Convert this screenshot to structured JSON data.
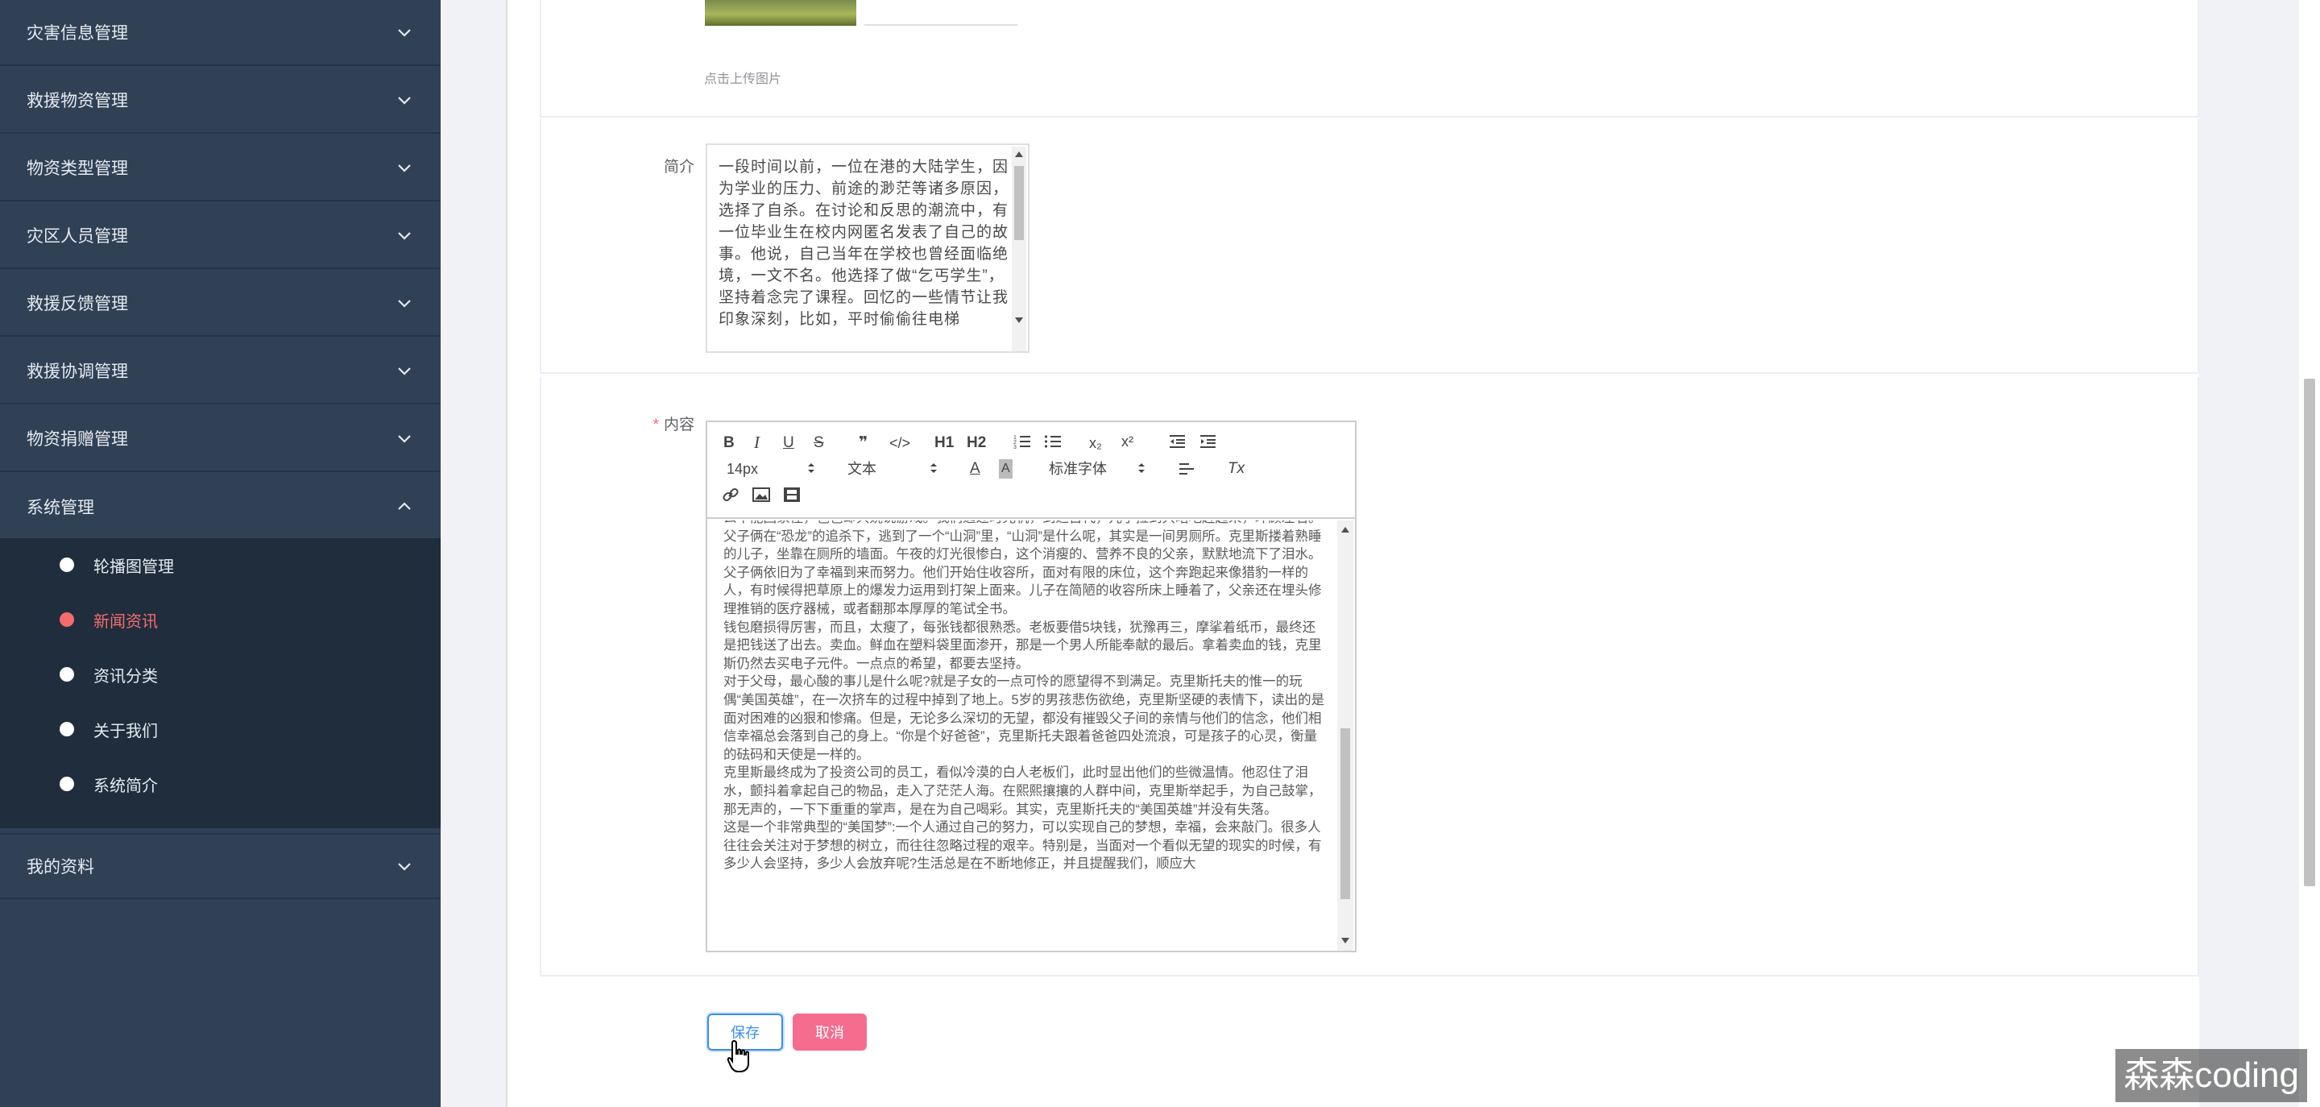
{
  "sidebar": {
    "menu": [
      {
        "label": "灾害信息管理"
      },
      {
        "label": "救援物资管理"
      },
      {
        "label": "物资类型管理"
      },
      {
        "label": "灾区人员管理"
      },
      {
        "label": "救援反馈管理"
      },
      {
        "label": "救援协调管理"
      },
      {
        "label": "物资捐赠管理"
      },
      {
        "label": "系统管理"
      },
      {
        "label": "我的资料"
      }
    ],
    "submenu": [
      {
        "label": "轮播图管理"
      },
      {
        "label": "新闻资讯"
      },
      {
        "label": "资讯分类"
      },
      {
        "label": "关于我们"
      },
      {
        "label": "系统简介"
      }
    ]
  },
  "colors": {
    "sidebar_bg": "#304156",
    "submenu_bg": "#1f2d3d",
    "active": "#f56c6c",
    "primary": "#3a8ee6",
    "danger": "#f56c8f"
  },
  "form": {
    "upload_hint": "点击上传图片",
    "intro_label": "简介",
    "intro_text": "一段时间以前，一位在港的大陆学生，因为学业的压力、前途的渺茫等诸多原因，选择了自杀。在讨论和反思的潮流中，有一位毕业生在校内网匿名发表了自己的故事。他说，自己当年在学校也曾经面临绝境，一文不名。他选择了做“乞丐学生”，坚持着念完了课程。回忆的一些情节让我印象深刻，比如，平时偷偷往电梯",
    "content_label": "内容",
    "required_mark": "*",
    "toolbar": {
      "bold": "B",
      "italic": "I",
      "underline": "U",
      "strike": "S",
      "quote": "❞",
      "code": "</>",
      "h1": "H1",
      "h2": "H2",
      "ordered_list": "⅓",
      "bullet_list": "☰",
      "subscript": "x₂",
      "superscript": "x²",
      "outdent": "⇤",
      "indent": "⇥",
      "size": "14px",
      "block": "文本",
      "font_color": "A",
      "bg_color": "A",
      "font_family": "标准字体",
      "align": "≡",
      "clean": "Tx",
      "link": "🔗",
      "image": "▣",
      "video": "▦"
    },
    "content_paragraphs": [
      "么不能回家住，爸爸却只婉说游戏。我们通过时光机，到达古代，儿子拉到只暗地赶起来，环顾左右。父子俩在“恐龙”的追杀下，逃到了一个“山洞”里，“山洞”是什么呢，其实是一间男厕所。克里斯搂着熟睡的儿子，坐靠在厕所的墙面。午夜的灯光很惨白，这个消瘦的、营养不良的父亲，默默地流下了泪水。",
      "父子俩依旧为了幸福到来而努力。他们开始住收容所，面对有限的床位，这个奔跑起来像猎豹一样的人，有时候得把草原上的爆发力运用到打架上面来。儿子在简陋的收容所床上睡着了，父亲还在埋头修理推销的医疗器械，或者翻那本厚厚的笔试全书。",
      "钱包磨损得厉害，而且，太瘦了，每张钱都很熟悉。老板要借5块钱，犹豫再三，摩挲着纸币，最终还是把钱送了出去。卖血。鲜血在塑料袋里面渗开，那是一个男人所能奉献的最后。拿着卖血的钱，克里斯仍然去买电子元件。一点点的希望，都要去坚持。",
      "对于父母，最心酸的事儿是什么呢?就是子女的一点可怜的愿望得不到满足。克里斯托夫的惟一的玩偶“美国英雄”，在一次挤车的过程中掉到了地上。5岁的男孩悲伤欲绝，克里斯坚硬的表情下，读出的是面对困难的凶狠和惨痛。但是，无论多么深切的无望，都没有摧毁父子间的亲情与他们的信念，他们相信幸福总会落到自己的身上。“你是个好爸爸”，克里斯托夫跟着爸爸四处流浪，可是孩子的心灵，衡量的砝码和天使是一样的。",
      "克里斯最终成为了投资公司的员工，看似冷漠的白人老板们，此时显出他们的些微温情。他忍住了泪水，颤抖着拿起自己的物品，走入了茫茫人海。在熙熙攘攘的人群中间，克里斯举起手，为自己鼓掌，那无声的，一下下重重的掌声，是在为自己喝彩。其实，克里斯托夫的“美国英雄”并没有失落。",
      "这是一个非常典型的“美国梦”:一个人通过自己的努力，可以实现自己的梦想，幸福，会来敲门。很多人往往会关注对于梦想的树立，而往往忽略过程的艰辛。特别是，当面对一个看似无望的现实的时候，有多少人会坚持，多少人会放弃呢?生活总是在不断地修正，并且提醒我们，顺应大"
    ]
  },
  "buttons": {
    "save": "保存",
    "cancel": "取消"
  },
  "watermark": "森森coding"
}
